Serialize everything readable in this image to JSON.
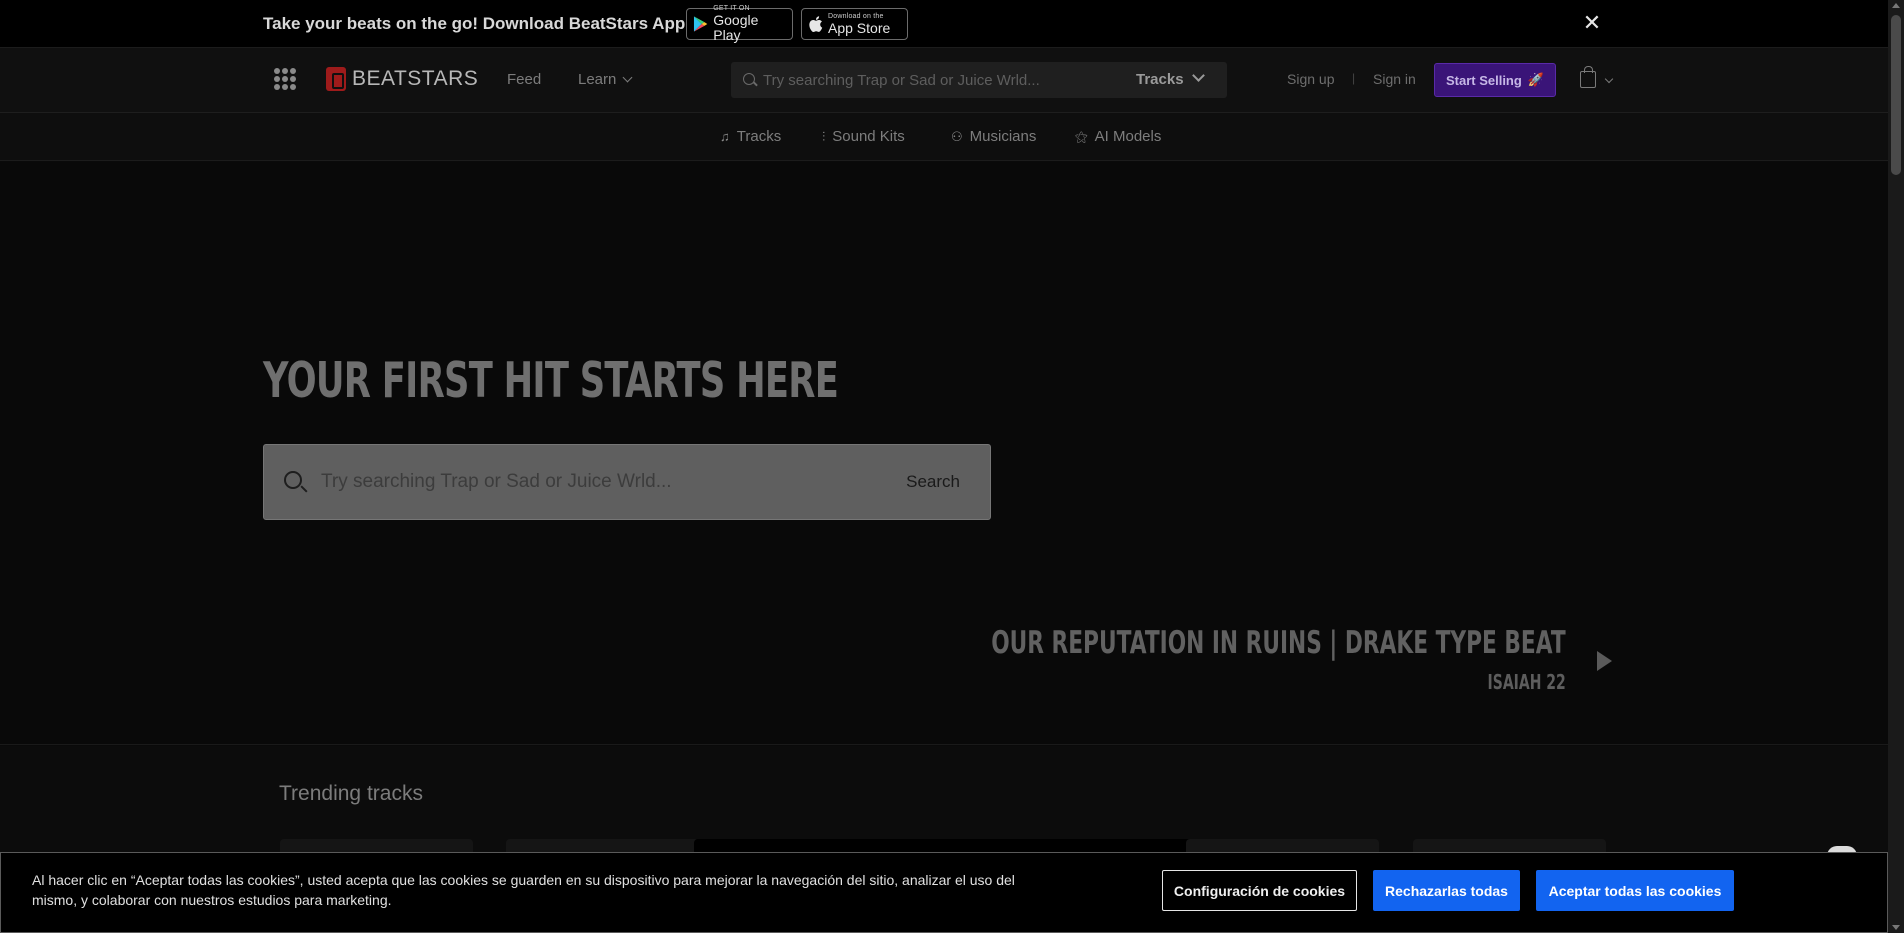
{
  "app_banner": {
    "text": "Take your beats on the go! Download BeatStars App",
    "google_play": {
      "small": "GET IT ON",
      "big": "Google Play"
    },
    "app_store": {
      "small": "Download on the",
      "big": "App Store"
    },
    "close": "✕"
  },
  "header": {
    "logo_text": "BEATSTARS",
    "feed": "Feed",
    "learn": "Learn",
    "search_placeholder": "Try searching Trap or Sad or Juice Wrld...",
    "search_scope": "Tracks",
    "sign_up": "Sign up",
    "separator": "|",
    "sign_in": "Sign in",
    "start_selling": "Start Selling",
    "rocket_icon": "🚀"
  },
  "subnav": {
    "items": [
      {
        "label": "Tracks",
        "icon": "♫"
      },
      {
        "label": "Sound Kits",
        "icon": "⫶"
      },
      {
        "label": "Musicians",
        "icon": "⚇"
      },
      {
        "label": "AI Models",
        "icon": "⚝"
      }
    ]
  },
  "hero": {
    "title": "YOUR FIRST HIT STARTS HERE",
    "search_placeholder": "Try searching Trap or Sad or Juice Wrld...",
    "search_button": "Search",
    "featured_title": "OUR REPUTATION IN RUINS | DRAKE TYPE BEAT",
    "featured_artist": "ISAIAH 22"
  },
  "trending": {
    "title": "Trending tracks"
  },
  "cookies": {
    "text": "Al hacer clic en “Aceptar todas las cookies”, usted acepta que las cookies se guarden en su dispositivo para mejorar la navegación del sitio, analizar el uso del mismo, y colaborar con nuestros estudios para marketing.",
    "settings": "Configuración de cookies",
    "reject": "Rechazarlas todas",
    "accept": "Aceptar todas las cookies"
  },
  "colors": {
    "accent_purple": "#3a1478",
    "cookie_blue": "#1264f0",
    "logo_red": "#9e1b1b"
  }
}
